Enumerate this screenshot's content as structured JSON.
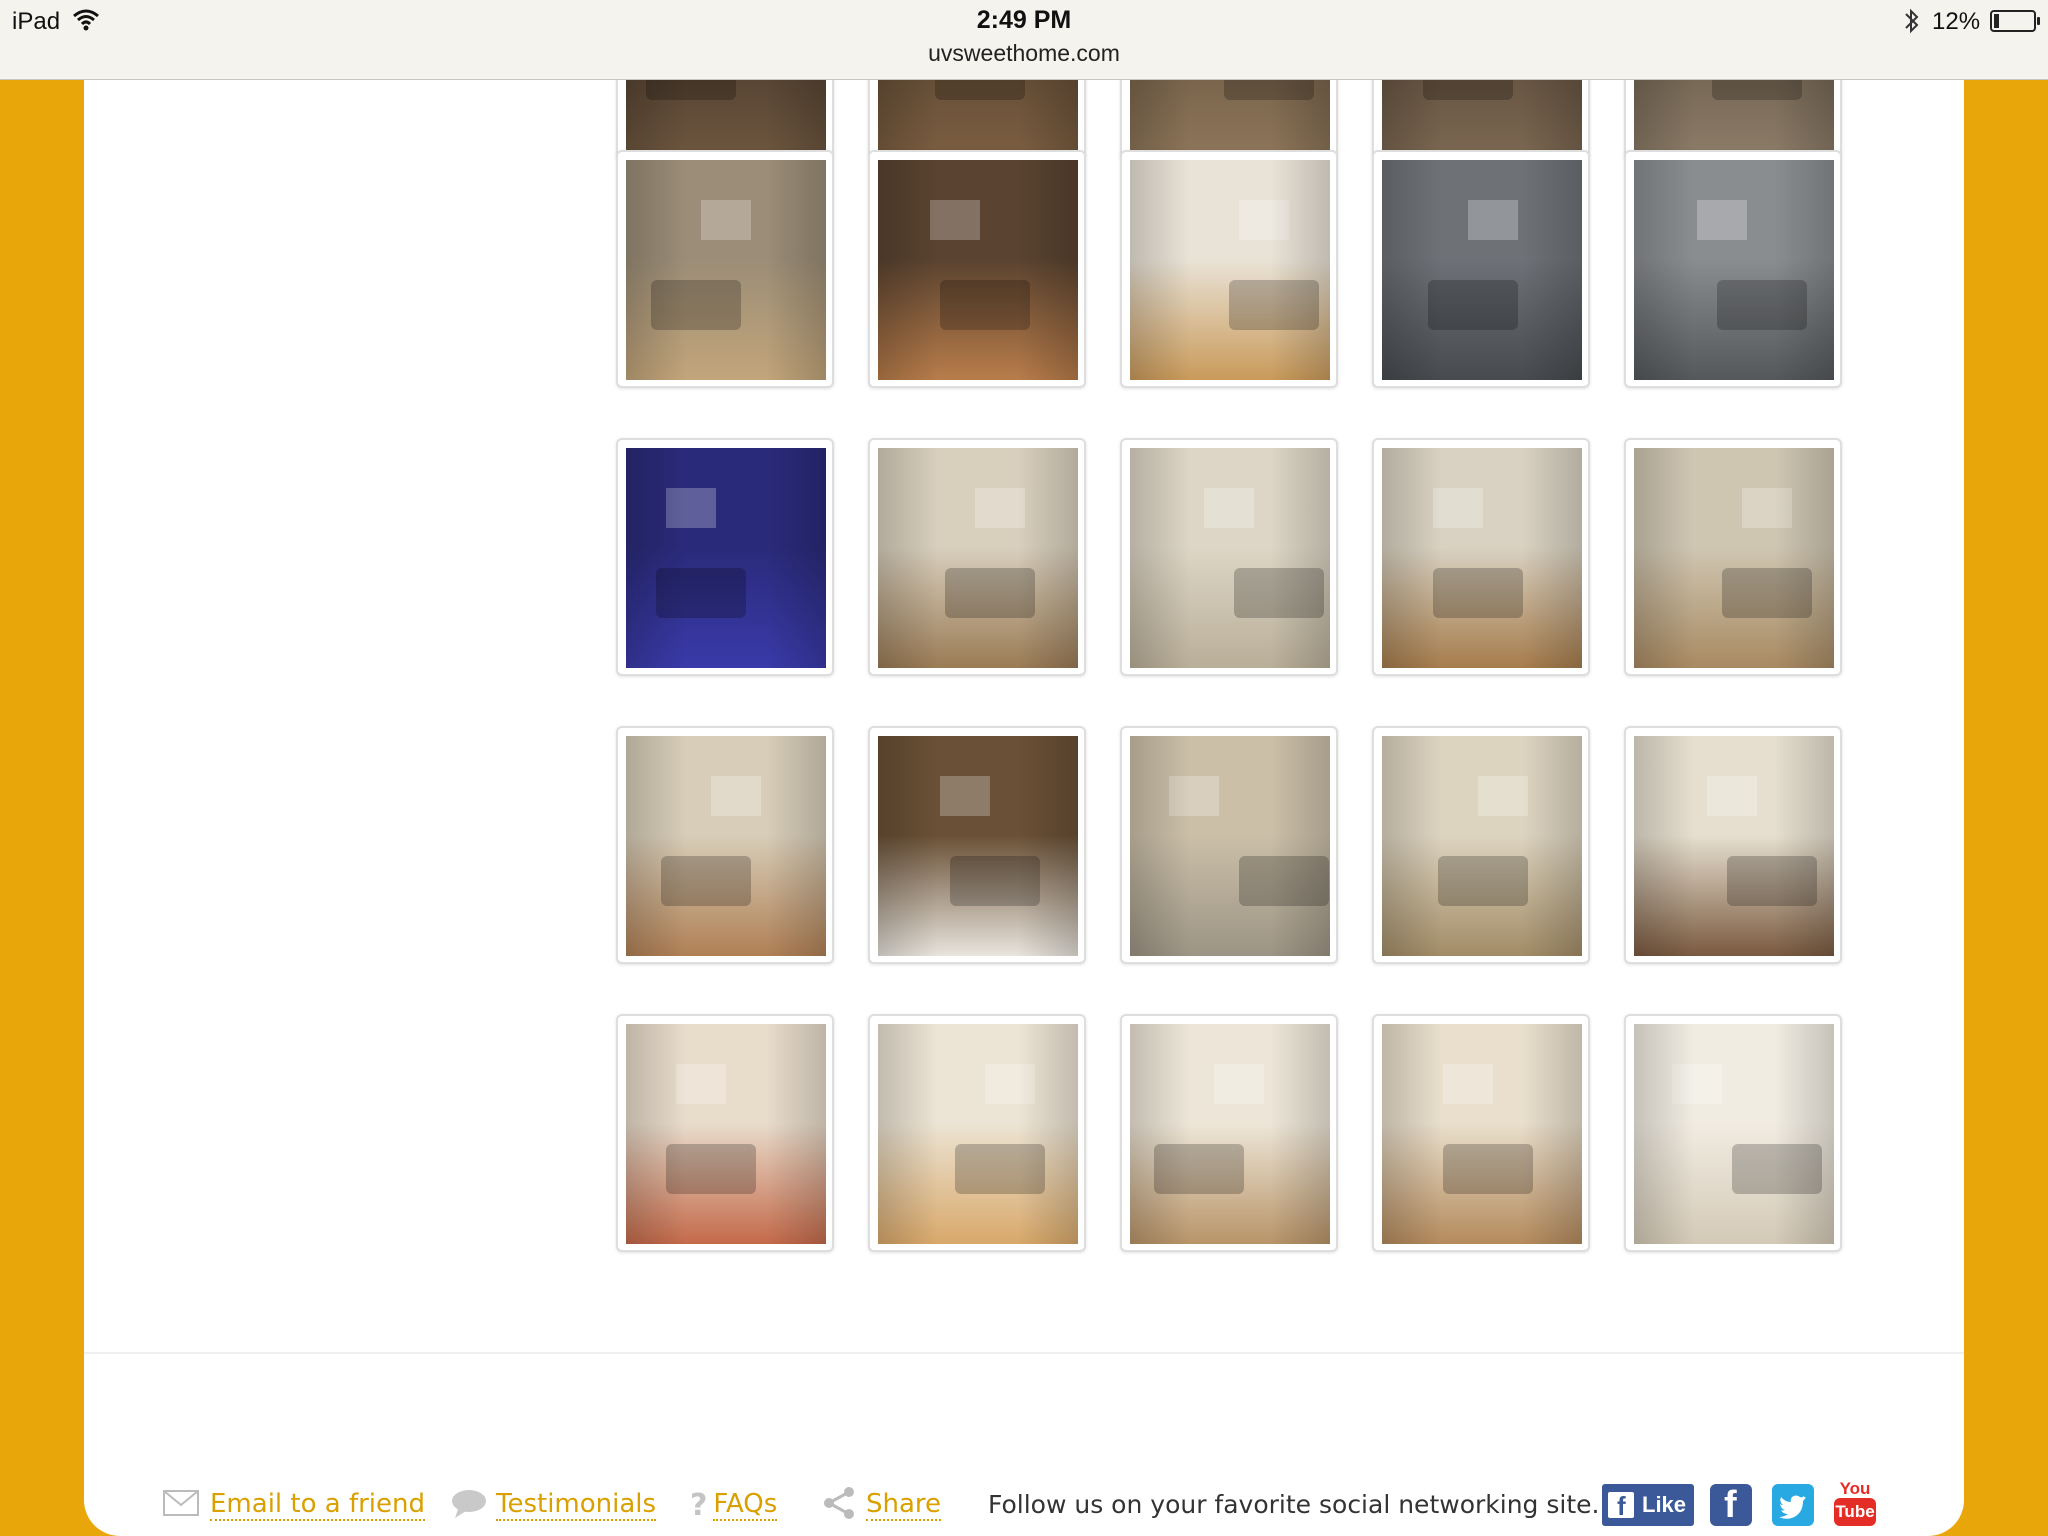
{
  "status_bar": {
    "device": "iPad",
    "time": "2:49 PM",
    "url": "uvsweethome.com",
    "battery_pct_label": "12%",
    "battery_level": 0.12
  },
  "gallery": {
    "rows": [
      {
        "kind": "cut-off-top",
        "items": [
          "photo-partial-1",
          "photo-partial-2",
          "photo-partial-3",
          "photo-partial-4",
          "photo-partial-5"
        ]
      },
      {
        "items": [
          "lounge-fireplace",
          "theater-room",
          "basketball-court",
          "fitness-center-1",
          "fitness-center-2"
        ]
      },
      {
        "items": [
          "tanning-bed",
          "apartment-living-kitchen-1",
          "apartment-living-room-1",
          "apartment-kitchen-1",
          "apartment-living-kitchen-2"
        ]
      },
      {
        "items": [
          "apartment-kitchen-2",
          "stacked-washer-dryer",
          "apartment-living-room-2",
          "apartment-living-room-3",
          "apartment-living-room-4"
        ]
      },
      {
        "items": [
          "bathroom-1",
          "bathroom-2",
          "bedroom-1",
          "bedroom-2",
          "bedroom-3"
        ]
      }
    ]
  },
  "footer": {
    "email_label": "Email to a friend",
    "testimonials_label": "Testimonials",
    "faqs_label": "FAQs",
    "share_label": "Share",
    "follow_text": "Follow us on your favorite social networking site.",
    "like_label": "Like",
    "youtube_top": "You",
    "youtube_bottom": "Tube",
    "colors": {
      "link": "#d9a000",
      "facebook": "#3b5998",
      "twitter": "#29a9e1",
      "youtube": "#e52d27",
      "page_bg": "#e8a60b"
    }
  }
}
